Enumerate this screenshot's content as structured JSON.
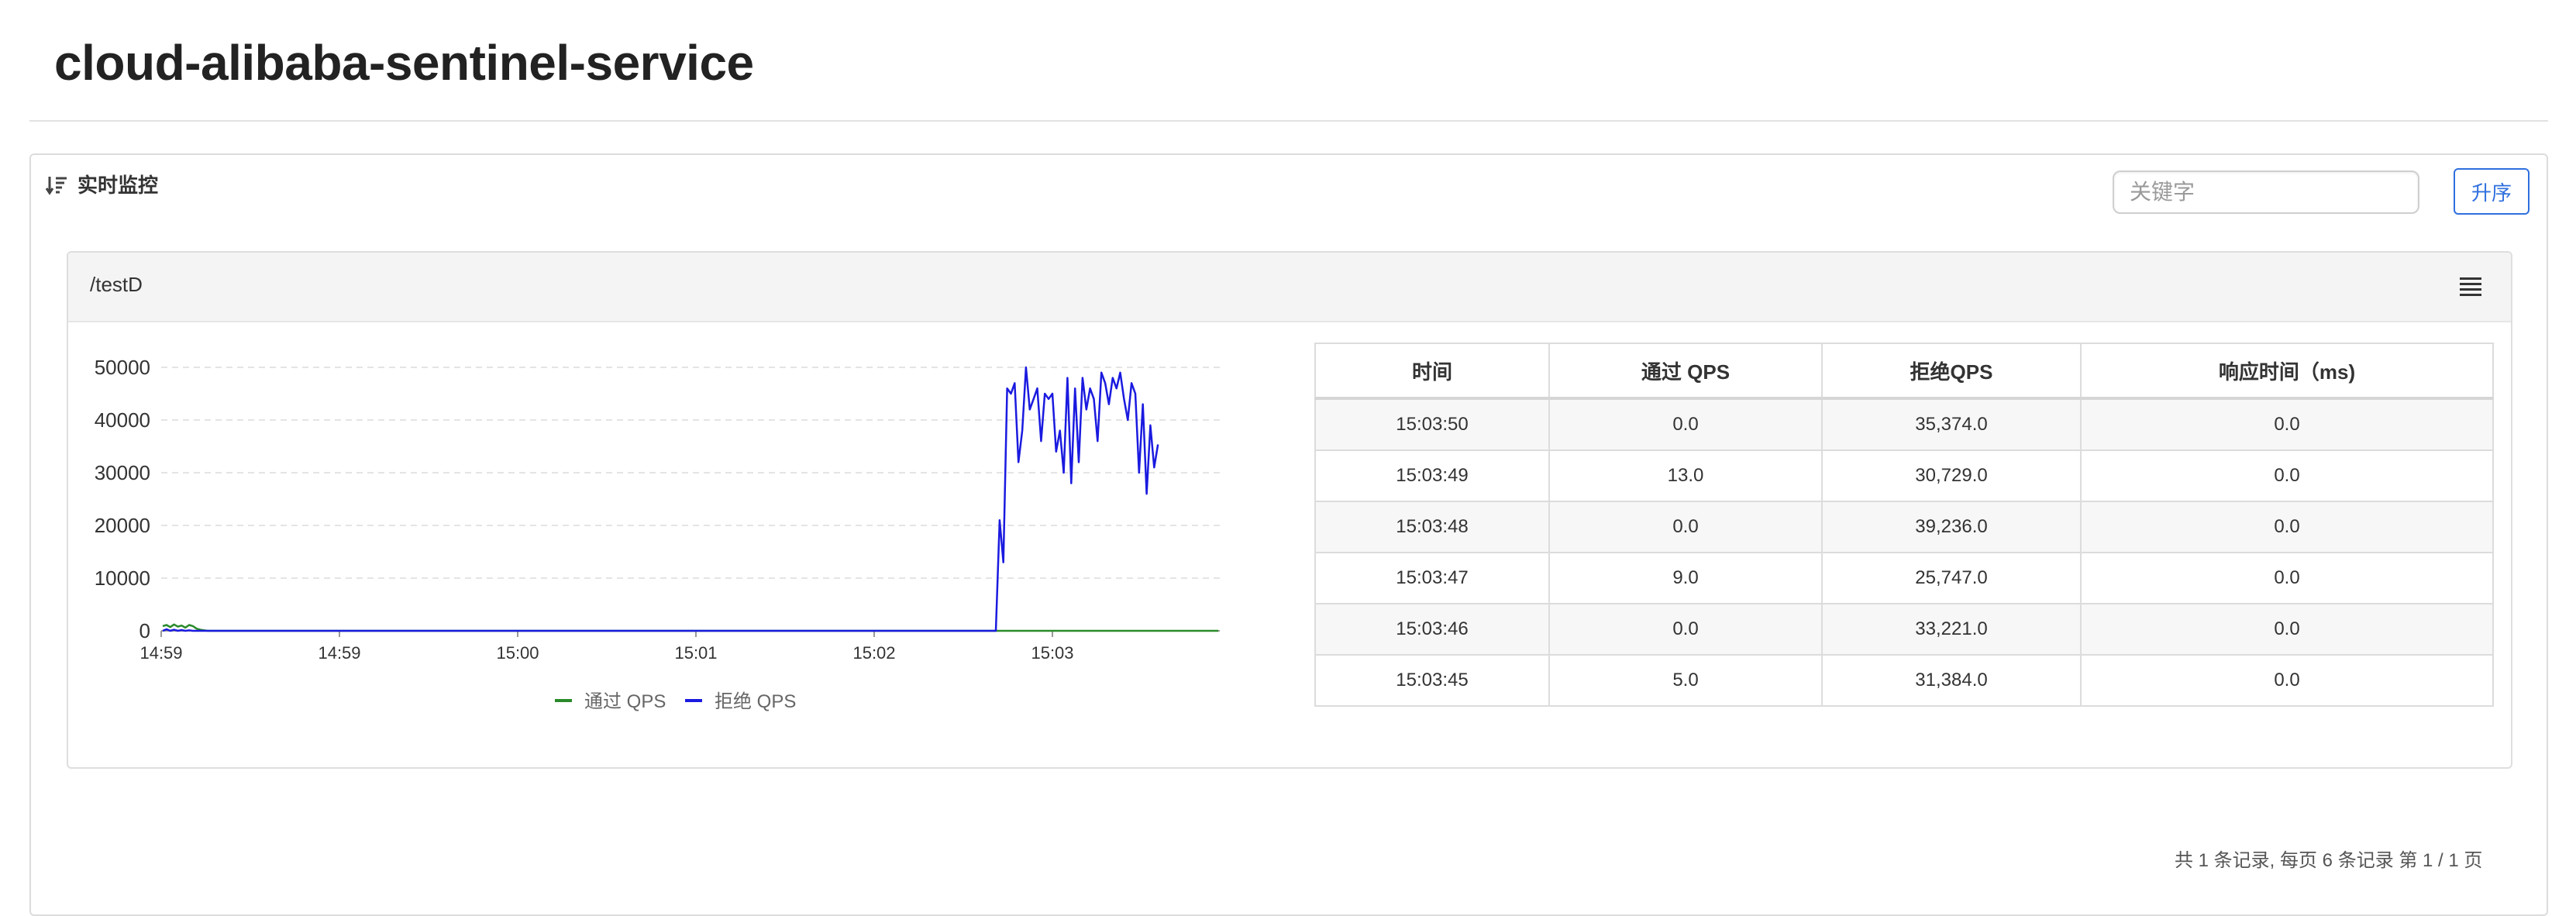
{
  "page": {
    "title": "cloud-alibaba-sentinel-service"
  },
  "panel": {
    "title": "实时监控",
    "search_placeholder": "关键字",
    "sort_label": "升序"
  },
  "card": {
    "resource": "/testD",
    "menu_icon": "menu-icon"
  },
  "chart_data": {
    "type": "line",
    "title": "",
    "xlabel": "",
    "ylabel": "",
    "ylim": [
      0,
      50000
    ],
    "y_ticks": [
      "0",
      "10000",
      "20000",
      "30000",
      "40000",
      "50000"
    ],
    "x_ticks": [
      "14:59",
      "14:59",
      "15:00",
      "15:01",
      "15:02",
      "15:03"
    ],
    "legend_position": "bottom",
    "grid": true,
    "series": [
      {
        "name": "通过 QPS",
        "color": "#2a8a2a",
        "values": [
          900,
          1100,
          700,
          1200,
          800,
          1000,
          600,
          1100,
          900,
          400,
          200,
          100,
          0,
          0,
          0,
          0,
          0,
          0,
          0,
          0,
          0,
          0,
          0,
          0,
          0,
          0,
          0,
          0,
          0,
          0,
          0,
          0,
          0,
          0,
          0,
          0,
          0,
          0,
          0,
          0,
          0,
          0,
          0,
          0,
          0,
          0,
          0,
          0,
          0,
          0,
          0,
          0,
          0,
          0,
          0,
          0,
          0,
          0,
          0,
          0,
          0,
          0,
          0,
          0,
          0,
          0,
          0,
          0,
          0,
          0,
          0,
          0,
          0,
          0,
          0,
          0,
          0,
          0,
          0,
          0,
          0,
          0,
          0,
          0,
          0,
          0,
          0,
          0,
          0,
          0,
          0,
          0,
          0,
          0,
          0,
          0,
          0,
          0,
          0,
          0,
          0,
          0,
          0,
          0,
          0,
          0,
          0,
          0,
          0,
          0,
          0,
          0,
          0,
          0,
          0,
          0,
          0,
          0,
          0,
          0,
          0,
          0,
          0,
          0,
          0,
          0,
          0,
          0,
          0,
          0,
          0,
          0,
          0,
          0,
          0,
          0,
          0,
          0,
          0,
          0,
          0,
          0,
          0,
          0,
          0,
          0,
          0,
          0,
          0,
          0,
          0,
          0,
          0,
          0,
          0,
          0,
          0,
          0,
          0,
          0,
          0,
          0,
          0,
          0,
          0,
          0,
          0,
          0,
          0,
          0,
          0,
          0,
          0,
          0,
          0,
          0,
          0,
          0,
          0,
          0,
          0,
          0,
          0,
          0,
          0,
          0,
          0,
          0,
          0,
          0,
          0,
          0,
          0,
          0,
          0,
          0,
          0,
          0,
          0,
          0,
          0,
          0,
          0,
          0,
          0,
          0,
          0,
          0,
          0,
          0,
          0,
          0,
          0,
          0,
          0,
          0,
          0,
          0,
          0,
          0,
          0,
          0,
          0,
          0,
          0,
          0,
          0,
          0,
          0,
          0,
          0,
          0,
          0,
          0,
          0,
          0,
          0,
          0,
          0,
          0,
          0,
          0,
          0,
          0,
          0,
          0,
          0,
          0,
          0,
          0,
          0,
          0,
          0,
          0,
          0,
          0,
          0,
          0,
          0,
          0,
          0,
          0,
          0,
          0,
          0,
          0,
          0,
          0,
          0,
          0,
          0,
          0,
          0,
          0,
          0,
          0,
          0,
          0,
          0,
          0,
          0
        ]
      },
      {
        "name": "拒绝 QPS",
        "color": "#1a1ae0",
        "values": [
          0,
          300,
          0,
          200,
          0,
          150,
          0,
          100,
          0,
          0,
          0,
          0,
          0,
          0,
          0,
          0,
          0,
          0,
          0,
          0,
          0,
          0,
          0,
          0,
          0,
          0,
          0,
          0,
          0,
          0,
          0,
          0,
          0,
          0,
          0,
          0,
          0,
          0,
          0,
          0,
          0,
          0,
          0,
          0,
          0,
          0,
          0,
          0,
          0,
          0,
          0,
          0,
          0,
          0,
          0,
          0,
          0,
          0,
          0,
          0,
          0,
          0,
          0,
          0,
          0,
          0,
          0,
          0,
          0,
          0,
          0,
          0,
          0,
          0,
          0,
          0,
          0,
          0,
          0,
          0,
          0,
          0,
          0,
          0,
          0,
          0,
          0,
          0,
          0,
          0,
          0,
          0,
          0,
          0,
          0,
          0,
          0,
          0,
          0,
          0,
          0,
          0,
          0,
          0,
          0,
          0,
          0,
          0,
          0,
          0,
          0,
          0,
          0,
          0,
          0,
          0,
          0,
          0,
          0,
          0,
          0,
          0,
          0,
          0,
          0,
          0,
          0,
          0,
          0,
          0,
          0,
          0,
          0,
          0,
          0,
          0,
          0,
          0,
          0,
          0,
          0,
          0,
          0,
          0,
          0,
          0,
          0,
          0,
          0,
          0,
          0,
          0,
          0,
          0,
          0,
          0,
          0,
          0,
          0,
          0,
          0,
          0,
          0,
          0,
          0,
          0,
          0,
          0,
          0,
          0,
          0,
          0,
          0,
          0,
          0,
          0,
          0,
          0,
          0,
          0,
          0,
          0,
          0,
          0,
          0,
          0,
          0,
          0,
          0,
          0,
          0,
          0,
          0,
          0,
          0,
          0,
          0,
          0,
          0,
          0,
          0,
          0,
          0,
          0,
          0,
          0,
          0,
          0,
          0,
          0,
          0,
          0,
          0,
          0,
          0,
          0,
          0,
          0,
          0,
          0,
          0,
          0,
          21000,
          13000,
          46000,
          45000,
          47000,
          32000,
          38000,
          50000,
          42000,
          44000,
          46000,
          36000,
          45000,
          44000,
          45000,
          34000,
          38000,
          30000,
          48000,
          28000,
          46000,
          32000,
          48000,
          42000,
          46000,
          44000,
          36000,
          49000,
          47000,
          43000,
          48000,
          46000,
          49000,
          44000,
          40000,
          47000,
          45000,
          30000,
          43000,
          26000,
          39000,
          31000,
          35374
        ]
      }
    ]
  },
  "table": {
    "headers": [
      "时间",
      "通过 QPS",
      "拒绝QPS",
      "响应时间（ms)"
    ],
    "rows": [
      [
        "15:03:50",
        "0.0",
        "35,374.0",
        "0.0"
      ],
      [
        "15:03:49",
        "13.0",
        "30,729.0",
        "0.0"
      ],
      [
        "15:03:48",
        "0.0",
        "39,236.0",
        "0.0"
      ],
      [
        "15:03:47",
        "9.0",
        "25,747.0",
        "0.0"
      ],
      [
        "15:03:46",
        "0.0",
        "33,221.0",
        "0.0"
      ],
      [
        "15:03:45",
        "5.0",
        "31,384.0",
        "0.0"
      ]
    ]
  },
  "pagination": {
    "text": "共 1 条记录, 每页 6 条记录 第 1 / 1 页"
  }
}
